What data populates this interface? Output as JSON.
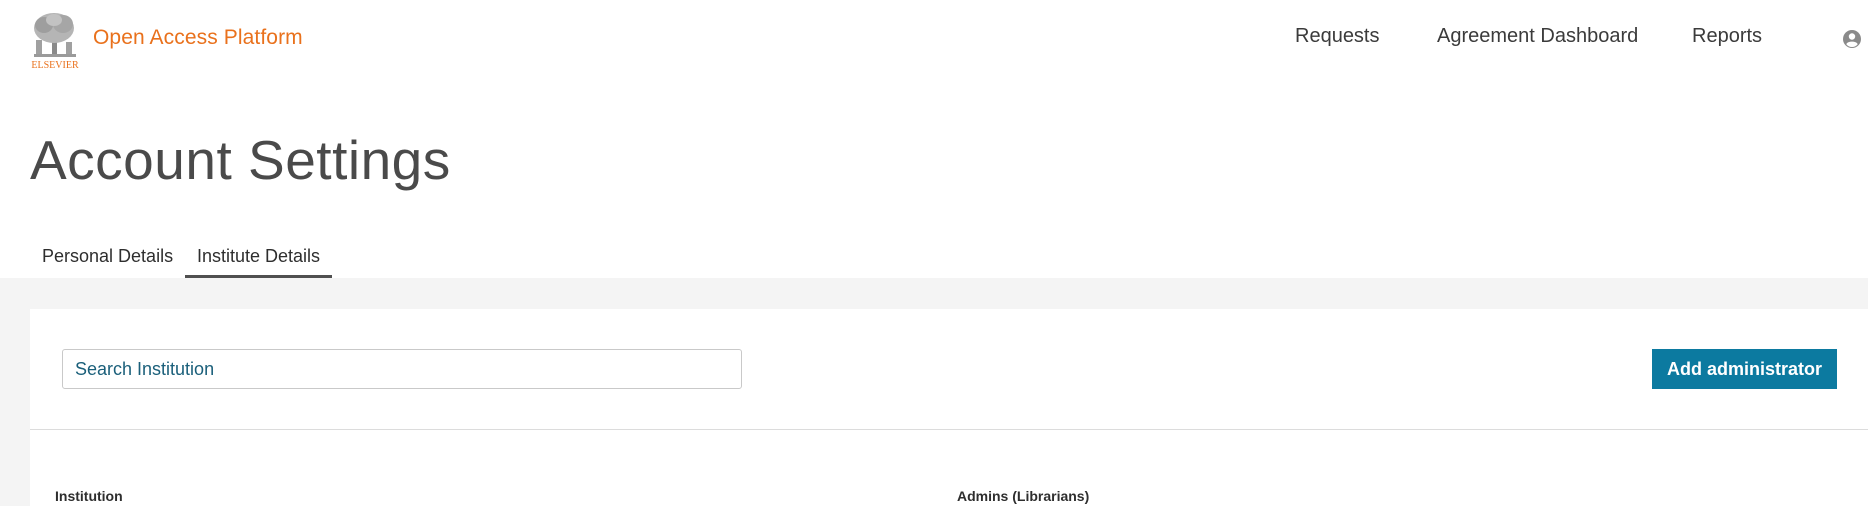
{
  "header": {
    "logo_text": "ELSEVIER",
    "brand": "Open Access Platform",
    "nav": {
      "requests": "Requests",
      "agreement_dashboard": "Agreement Dashboard",
      "reports": "Reports"
    },
    "user_icon": "user-avatar-icon"
  },
  "page": {
    "title": "Account Settings"
  },
  "tabs": {
    "personal": "Personal Details",
    "institute": "Institute Details",
    "active": "Institute Details"
  },
  "panel": {
    "search_placeholder": "Search Institution",
    "add_admin_label": "Add administrator",
    "columns": [
      "Institution",
      "Admins (Librarians)"
    ]
  },
  "colors": {
    "brand_orange": "#e9711c",
    "primary_button": "#0c7aa0",
    "link_text": "#1a5f7a"
  }
}
